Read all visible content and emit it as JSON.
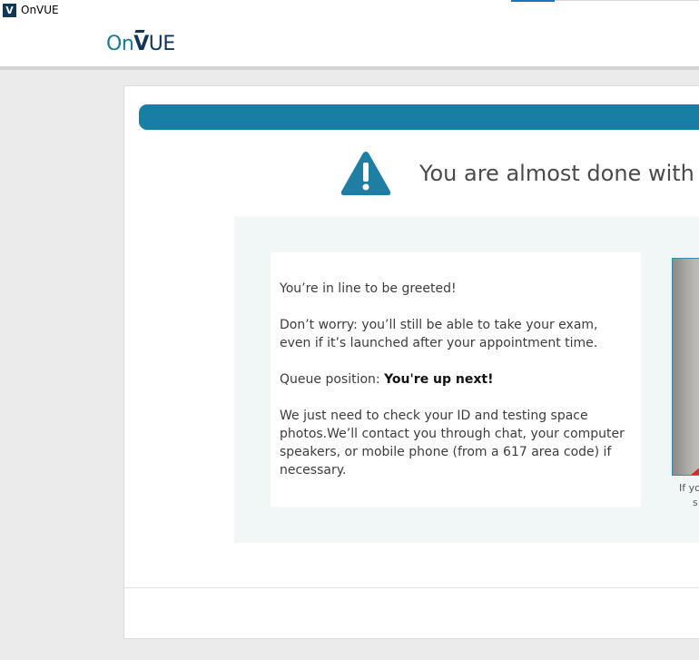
{
  "window": {
    "title": "OnVUE",
    "icon_letter": "V"
  },
  "logo": {
    "on": "On",
    "v": "V",
    "ue": "UE"
  },
  "main": {
    "heading": "You are almost done with th",
    "message": {
      "line1": "You’re in line to be greeted!",
      "line2": "Don’t worry: you’ll still be able to take your exam, even if it’s launched after your appointment time.",
      "queue_label": "Queue position: ",
      "queue_value": "You're up next!",
      "line4": "We just need to check your ID and testing space photos.We’ll contact you through chat, your computer speakers, or mobile phone (from a 617 area code) if necessary."
    },
    "camera_caption_line1": "If yo",
    "camera_caption_line2": "s"
  },
  "colors": {
    "accent": "#167fa3",
    "brand_navy": "#12355b",
    "panel_bg": "#f1f7f6"
  },
  "icons": {
    "warning": "warning-triangle-icon",
    "app": "onvue-app-icon"
  }
}
